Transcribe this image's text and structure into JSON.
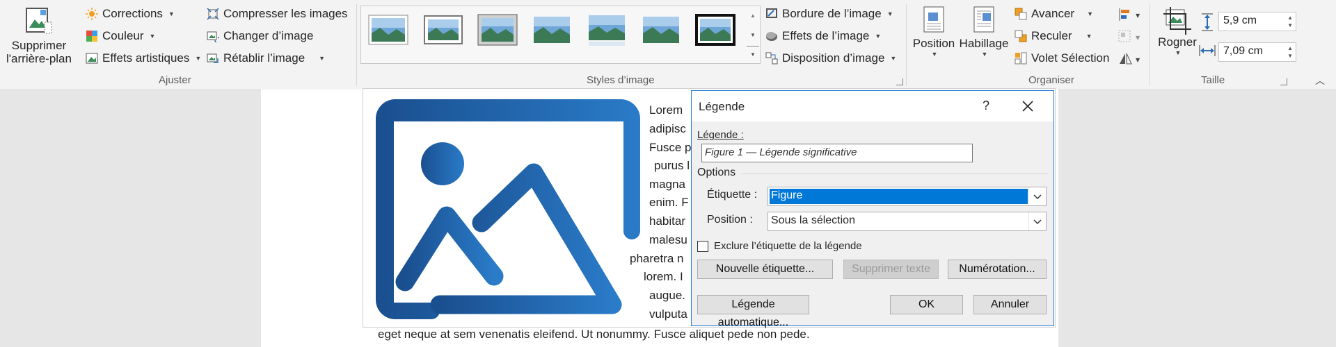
{
  "ribbon": {
    "ajuster": {
      "remove_bg": [
        "Supprimer",
        "l'arrière-plan"
      ],
      "corrections": "Corrections",
      "couleur": "Couleur",
      "effets_artistiques": "Effets artistiques",
      "compresser": "Compresser les images",
      "changer": "Changer d’image",
      "retablir": "Rétablir l’image",
      "group_label": "Ajuster"
    },
    "styles": {
      "group_label": "Styles d’image",
      "bordure": "Bordure de l’image",
      "effets": "Effets de l’image",
      "disposition": "Disposition d’image"
    },
    "organiser": {
      "position": "Position",
      "habillage": "Habillage",
      "avancer": "Avancer",
      "reculer": "Reculer",
      "volet": "Volet Sélection",
      "group_label": "Organiser"
    },
    "taille": {
      "rogner": "Rogner",
      "hauteur": "5,9 cm",
      "largeur": "7,09 cm",
      "group_label": "Taille"
    }
  },
  "document": {
    "lines_right": [
      "Lorem",
      "adipisc",
      "Fusce p",
      "purus l",
      "magna",
      "enim. F",
      "habitar",
      "malesu",
      "pharetra n",
      "lorem. I",
      "augue.",
      "vulputa"
    ],
    "bottom_line": "eget neque at sem venenatis eleifend. Ut nonummy. Fusce aliquet pede non pede."
  },
  "dialog": {
    "title": "Légende",
    "help": "?",
    "legend_label": "Légende :",
    "legend_value": "Figure 1 — Légende significative",
    "options_label": "Options",
    "etiquette_label": "Étiquette :",
    "etiquette_value": "Figure",
    "position_label": "Position :",
    "position_value": "Sous la sélection",
    "exclude_label": "Exclure l’étiquette de la légende",
    "exclude_checked": false,
    "new_label_btn": "Nouvelle étiquette...",
    "delete_label_btn": "Supprimer texte",
    "numbering_btn": "Numérotation...",
    "auto_btn": "Légende automatique...",
    "ok_btn": "OK",
    "cancel_btn": "Annuler"
  },
  "colors": {
    "accent": "#1e7ad8",
    "image_blue": "#1d5fa6",
    "selection": "#0078d7"
  }
}
